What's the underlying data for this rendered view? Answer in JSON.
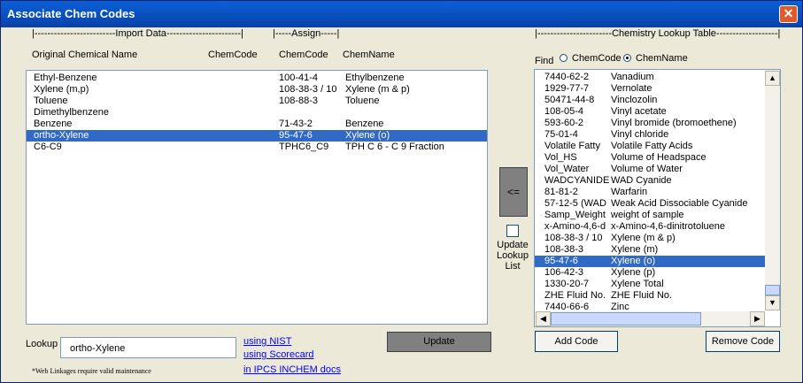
{
  "window": {
    "title": "Associate Chem Codes",
    "close_glyph": "✕"
  },
  "headers": {
    "import_data": "|-------------------------Import Data-----------------------|",
    "assign": "|-----Assign-----|",
    "chemistry_lookup": "|-----------------------Chemistry Lookup Table-------------------|"
  },
  "columns": {
    "original_name": "Original Chemical Name",
    "chemcode": "ChemCode",
    "chemcode2": "ChemCode",
    "chemname": "ChemName"
  },
  "import_rows": [
    {
      "name": "Ethyl-Benzene",
      "chemcode": "",
      "assign_code": "100-41-4",
      "assign_name": "Ethylbenzene"
    },
    {
      "name": "Xylene (m,p)",
      "chemcode": "",
      "assign_code": "108-38-3 / 10",
      "assign_name": "Xylene (m & p)"
    },
    {
      "name": "Toluene",
      "chemcode": "",
      "assign_code": "108-88-3",
      "assign_name": "Toluene"
    },
    {
      "name": "Dimethylbenzene",
      "chemcode": "",
      "assign_code": "",
      "assign_name": ""
    },
    {
      "name": "Benzene",
      "chemcode": "",
      "assign_code": "71-43-2",
      "assign_name": "Benzene"
    },
    {
      "name": "ortho-Xylene",
      "chemcode": "",
      "assign_code": "95-47-6",
      "assign_name": "Xylene (o)"
    },
    {
      "name": "C6-C9",
      "chemcode": "",
      "assign_code": "TPHC6_C9",
      "assign_name": "TPH C 6 - C 9 Fraction"
    }
  ],
  "import_selected_index": 5,
  "find": {
    "label": "Find",
    "opt_chemcode": "ChemCode",
    "opt_chemname": "ChemName",
    "selected": "ChemName"
  },
  "lookup_rows": [
    {
      "code": "7440-62-2",
      "name": "Vanadium"
    },
    {
      "code": "1929-77-7",
      "name": "Vernolate"
    },
    {
      "code": "50471-44-8",
      "name": "Vinclozolin"
    },
    {
      "code": "108-05-4",
      "name": "Vinyl acetate"
    },
    {
      "code": "593-60-2",
      "name": "Vinyl bromide (bromoethene)"
    },
    {
      "code": "75-01-4",
      "name": "Vinyl chloride"
    },
    {
      "code": "Volatile Fatty",
      "name": "Volatile Fatty Acids"
    },
    {
      "code": "Vol_HS",
      "name": "Volume of Headspace"
    },
    {
      "code": "Vol_Water",
      "name": "Volume of Water"
    },
    {
      "code": "WADCYANIDE",
      "name": "WAD Cyanide"
    },
    {
      "code": "81-81-2",
      "name": "Warfarin"
    },
    {
      "code": "57-12-5 (WAD",
      "name": "Weak Acid Dissociable Cyanide"
    },
    {
      "code": "Samp_Weight",
      "name": "weight of sample"
    },
    {
      "code": "x-Amino-4,6-d",
      "name": "x-Amino-4,6-dinitrotoluene"
    },
    {
      "code": "108-38-3 / 10",
      "name": "Xylene (m & p)"
    },
    {
      "code": "108-38-3",
      "name": "Xylene (m)"
    },
    {
      "code": "95-47-6",
      "name": "Xylene (o)"
    },
    {
      "code": "106-42-3",
      "name": "Xylene (p)"
    },
    {
      "code": "1330-20-7",
      "name": "Xylene Total"
    },
    {
      "code": "ZHE Fluid No.",
      "name": "ZHE Fluid No."
    },
    {
      "code": "7440-66-6",
      "name": "Zinc"
    }
  ],
  "lookup_selected_index": 16,
  "assign_button": "<=",
  "update_lookup": {
    "line1": "Update",
    "line2": "Lookup",
    "line3": "List",
    "checked": false
  },
  "lookup": {
    "label": "Lookup",
    "value": "ortho-Xylene"
  },
  "links": {
    "nist": "using NIST",
    "scorecard": "using Scorecard",
    "ipcs": "in IPCS INCHEM docs"
  },
  "note": "*Web Linkages require valid maintenance",
  "buttons": {
    "update": "Update",
    "add_code": "Add Code",
    "remove_code": "Remove Code"
  },
  "scroll_glyphs": {
    "up": "▲",
    "down": "▼",
    "left": "◀",
    "right": "▶"
  },
  "colors": {
    "titlebar": "#0842a8",
    "selection": "#316ac5",
    "dialog": "#ece9d8",
    "link": "#0000ff"
  }
}
